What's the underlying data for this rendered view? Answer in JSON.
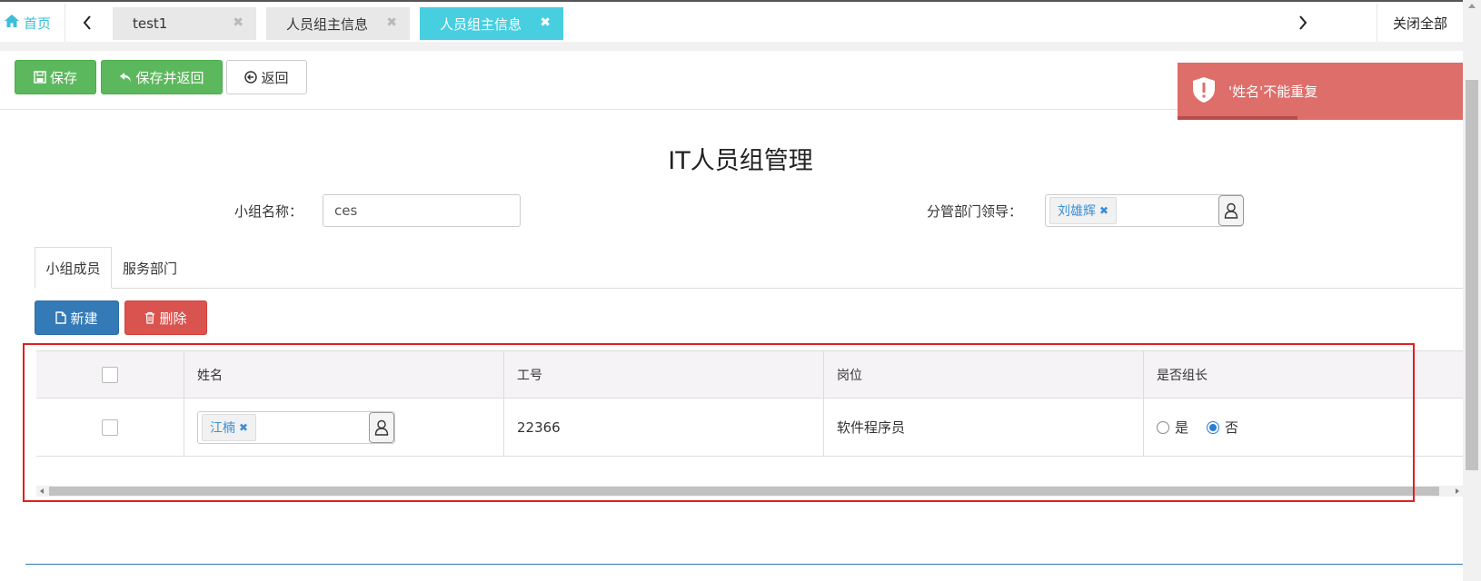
{
  "tabbar": {
    "home_label": "首页",
    "tabs": [
      {
        "label": "test1"
      },
      {
        "label": "人员组主信息"
      },
      {
        "label": "人员组主信息"
      }
    ],
    "close_all": "关闭全部",
    "close_glyph": "✖",
    "prev_glyph": "‹",
    "next_glyph": "›"
  },
  "toolbar": {
    "save_label": "保存",
    "save_return_label": "保存并返回",
    "back_label": "返回"
  },
  "toast": {
    "message": "'姓名'不能重复",
    "color": "#dd6e6a"
  },
  "form": {
    "title": "IT人员组管理",
    "group_name_label": "小组名称：",
    "group_name_value": "ces",
    "leader_label": "分管部门领导：",
    "leader_tag": "刘雄辉"
  },
  "subtabs": {
    "members": "小组成员",
    "departments": "服务部门"
  },
  "grid_toolbar": {
    "new_label": "新建",
    "delete_label": "删除"
  },
  "grid": {
    "columns": [
      "姓名",
      "工号",
      "岗位",
      "是否组长"
    ],
    "rows": [
      {
        "name_tag": "江楠",
        "employee_no": "22366",
        "position": "软件程序员",
        "is_leader_yes": "是",
        "is_leader_no": "否",
        "is_leader": "否"
      }
    ]
  },
  "colors": {
    "accent_tab": "#47cfe0",
    "green": "#5cb85c",
    "blue": "#337ab7",
    "red": "#d9534f",
    "highlight": "#e01f1f"
  }
}
